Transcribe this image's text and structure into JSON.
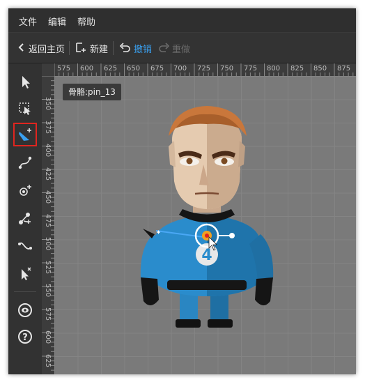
{
  "menu": {
    "file": "文件",
    "edit": "编辑",
    "help": "帮助"
  },
  "toolbar": {
    "back_label": "返回主页",
    "new_label": "新建",
    "undo_label": "撤销",
    "redo_label": "重做"
  },
  "tools": [
    {
      "name": "select-tool",
      "icon": "arrow-pointer-icon"
    },
    {
      "name": "marquee-select-tool",
      "icon": "dashed-select-icon"
    },
    {
      "name": "create-bone-tool",
      "icon": "bone-add-icon",
      "active": true
    },
    {
      "name": "curve-tool",
      "icon": "curve-icon"
    },
    {
      "name": "add-point-tool",
      "icon": "point-add-icon"
    },
    {
      "name": "bind-tool",
      "icon": "bind-icon"
    },
    {
      "name": "path-tool",
      "icon": "path-icon"
    },
    {
      "name": "delete-tool",
      "icon": "pointer-delete-icon"
    },
    {
      "name": "visibility-tool",
      "icon": "eye-icon"
    },
    {
      "name": "help-tool",
      "icon": "question-icon"
    }
  ],
  "ruler": {
    "top_labels": [
      "575",
      "600",
      "625",
      "650",
      "675",
      "700",
      "725",
      "750",
      "775",
      "800",
      "825",
      "850",
      "875"
    ],
    "left_labels": [
      "350",
      "375",
      "400",
      "425",
      "450",
      "475",
      "500",
      "525",
      "550",
      "575",
      "600",
      "625"
    ]
  },
  "tooltip": {
    "text": "骨骼:pin_13"
  },
  "colors": {
    "accent": "#3aa0f0",
    "active_outline": "#e0251f",
    "canvas": "#7a7a7a"
  }
}
